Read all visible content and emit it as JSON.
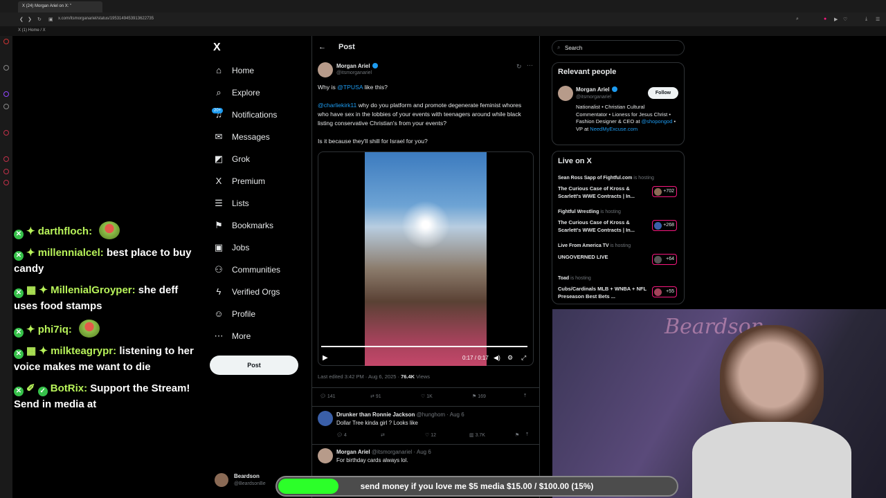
{
  "browser": {
    "tab_title": "(24) Morgan Ariel on X: \"",
    "url": "x.com/itsmorganariel/status/1953149453913622735",
    "bookmark": "(1) Home / X"
  },
  "chat": {
    "messages": [
      {
        "user": "darthfloch:",
        "text": ""
      },
      {
        "user": "millennialcel:",
        "text": "best place to buy candy"
      },
      {
        "user": "MillenialGroyper:",
        "text": "she deff uses food stamps"
      },
      {
        "user": "phi7iq:",
        "text": ""
      },
      {
        "user": "milkteagrypr:",
        "text": "listening to her voice makes me want to die"
      },
      {
        "user": "BotRix:",
        "text": "Support the Stream! Send in media at"
      }
    ]
  },
  "nav": {
    "logo": "X",
    "items": [
      {
        "label": "Home",
        "icon": "⌂"
      },
      {
        "label": "Explore",
        "icon": "⌕"
      },
      {
        "label": "Notifications",
        "icon": "♫"
      },
      {
        "label": "Messages",
        "icon": "✉"
      },
      {
        "label": "Grok",
        "icon": "◩"
      },
      {
        "label": "Premium",
        "icon": "X"
      },
      {
        "label": "Lists",
        "icon": "☰"
      },
      {
        "label": "Bookmarks",
        "icon": "⚑"
      },
      {
        "label": "Jobs",
        "icon": "▣"
      },
      {
        "label": "Communities",
        "icon": "⚇"
      },
      {
        "label": "Verified Orgs",
        "icon": "ϟ"
      },
      {
        "label": "Profile",
        "icon": "☺"
      },
      {
        "label": "More",
        "icon": "⋯"
      }
    ],
    "notifications_badge": "20+",
    "post_button": "Post",
    "account": {
      "name": "Beardson",
      "handle": "@BeardsonBe"
    }
  },
  "post": {
    "header": "Post",
    "author": {
      "name": "Morgan Ariel",
      "handle": "@itsmorganariel"
    },
    "text": {
      "line1_prefix": "Why is ",
      "mention1": "@TPUSA",
      "line1_suffix": " like this?",
      "mention2": "@charliekirk11",
      "para2": " why do you platform and promote degenerate feminist whores who have sex in the lobbies of your events with teenagers around while black listing conservative Christian's from your events?",
      "para3": "Is it because they'll shill for Israel for you?"
    },
    "video": {
      "time": "0:17 / 0:17",
      "progress": 1.0
    },
    "meta": {
      "edited": "Last edited 3:42 PM · Aug 6, 2025 · ",
      "views": "76.4K",
      "views_label": " Views"
    },
    "actions": {
      "replies": "141",
      "reposts": "91",
      "likes": "1K",
      "bookmarks": "169"
    }
  },
  "replies": [
    {
      "name": "Drunker than Ronnie Jackson",
      "handle": "@hunghom · Aug 6",
      "text": "Dollar Tree kinda girl ? Looks like",
      "replies": "4",
      "likes": "12",
      "views": "3.7K"
    },
    {
      "name": "Morgan Ariel",
      "handle": "@itsmorganariel · Aug 6",
      "text": "For birthday cards always lol."
    }
  ],
  "sidebar": {
    "search_placeholder": "Search",
    "relevant_title": "Relevant people",
    "relevant": {
      "name": "Morgan Ariel",
      "handle": "@itsmorganariel",
      "follow": "Follow",
      "bio_text": "Nationalist • Christian Cultural Commentator • Lioness for Jesus Christ • Fashion Designer & CEO at ",
      "bio_link1": "@shopongod",
      "bio_mid": " • VP at ",
      "bio_link2": "NeedMyExcuse.com"
    },
    "live_title": "Live on X",
    "live": [
      {
        "host": "Sean Ross Sapp of Fightful.com",
        "status": "is hosting",
        "title": "The Curious Case of Kross & Scarlett's WWE Contracts | In...",
        "count": "+702"
      },
      {
        "host": "Fightful Wrestling",
        "status": "is hosting",
        "title": "The Curious Case of Kross & Scarlett's WWE Contracts | In...",
        "count": "+268"
      },
      {
        "host": "Live From America TV",
        "status": "is hosting",
        "title": "UNGOVERNED LIVE",
        "count": "+64"
      },
      {
        "host": "Toad",
        "status": "is hosting",
        "title": "Cubs/Cardinals MLB + WNBA + NFL Preseason Best Bets ...",
        "count": "+55"
      }
    ]
  },
  "goal": {
    "text": "send money if you love me $5 media $15.00 / $100.00 (15%)",
    "progress": 0.15
  },
  "colors": {
    "accent": "#1d9bf0",
    "live": "#f91880",
    "goal": "#2cff29",
    "chat_name": "#b8f35a"
  }
}
